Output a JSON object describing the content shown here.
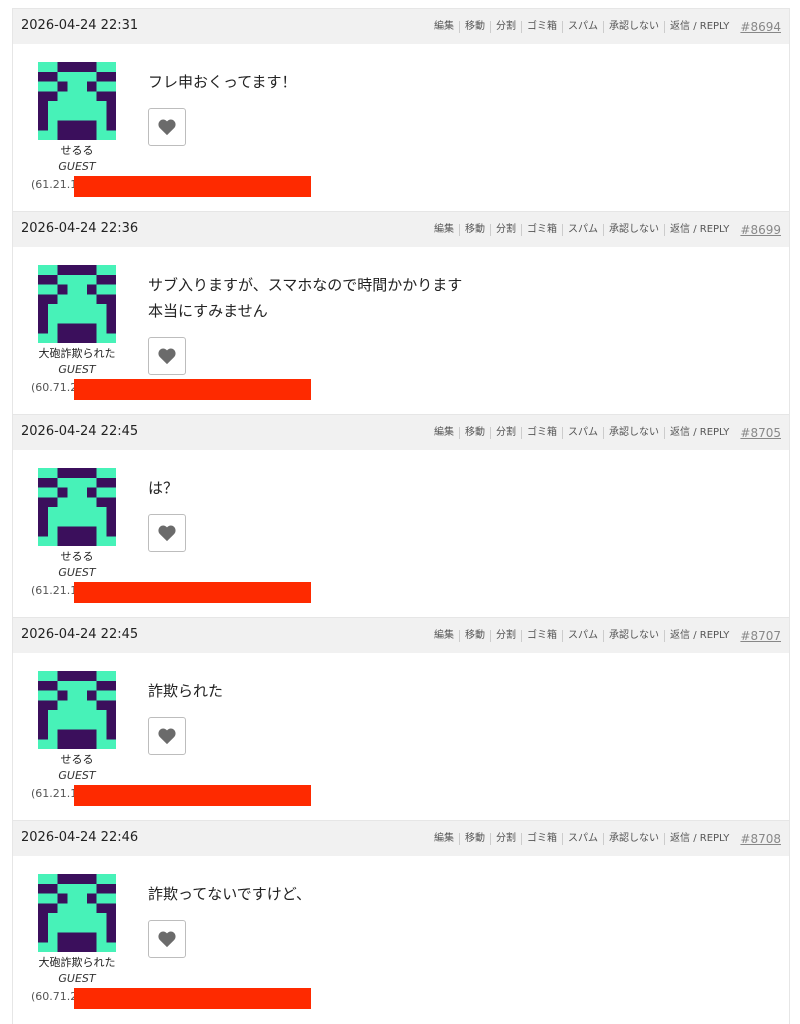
{
  "colors": {
    "avatar_bg": "#3b0f5c",
    "avatar_fg": "#47f2b8",
    "redaction": "#fe2a00",
    "header_bg": "#f1f1f1",
    "heart": "#6b6b6b"
  },
  "action_icon": "heart-icon",
  "comments": [
    {
      "timestamp": "2026-04-24 22:31",
      "actions": [
        "編集",
        "移動",
        "分割",
        "ゴミ箱",
        "スパム",
        "承認しない",
        "返信 / REPLY"
      ],
      "permalink": "#8694",
      "author": "せるる",
      "role": "GUEST",
      "ip": "(61.21.1",
      "lines": [
        "フレ申おくってます！"
      ]
    },
    {
      "timestamp": "2026-04-24 22:36",
      "actions": [
        "編集",
        "移動",
        "分割",
        "ゴミ箱",
        "スパム",
        "承認しない",
        "返信 / REPLY"
      ],
      "permalink": "#8699",
      "author": "大砲詐欺られた",
      "role": "GUEST",
      "ip": "(60.71.2",
      "lines": [
        "サブ入りますが、スマホなので時間かかります",
        "本当にすみません"
      ]
    },
    {
      "timestamp": "2026-04-24 22:45",
      "actions": [
        "編集",
        "移動",
        "分割",
        "ゴミ箱",
        "スパム",
        "承認しない",
        "返信 / REPLY"
      ],
      "permalink": "#8705",
      "author": "せるる",
      "role": "GUEST",
      "ip": "(61.21.1",
      "lines": [
        "は？"
      ]
    },
    {
      "timestamp": "2026-04-24 22:45",
      "actions": [
        "編集",
        "移動",
        "分割",
        "ゴミ箱",
        "スパム",
        "承認しない",
        "返信 / REPLY"
      ],
      "permalink": "#8707",
      "author": "せるる",
      "role": "GUEST",
      "ip": "(61.21.1",
      "lines": [
        "詐欺られた"
      ]
    },
    {
      "timestamp": "2026-04-24 22:46",
      "actions": [
        "編集",
        "移動",
        "分割",
        "ゴミ箱",
        "スパム",
        "承認しない",
        "返信 / REPLY"
      ],
      "permalink": "#8708",
      "author": "大砲詐欺られた",
      "role": "GUEST",
      "ip": "(60.71.2",
      "lines": [
        "詐欺ってないですけど、"
      ]
    }
  ]
}
